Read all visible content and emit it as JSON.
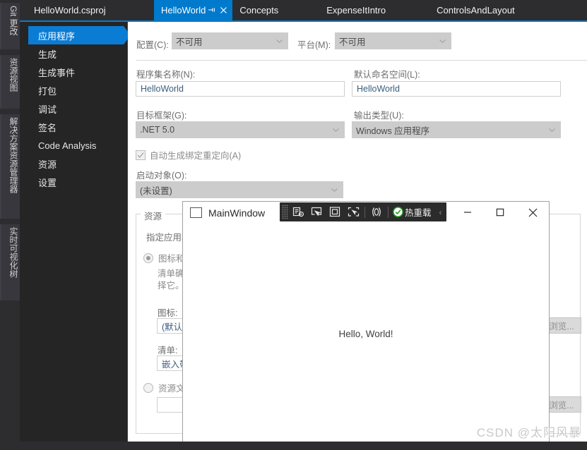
{
  "colors": {
    "accent": "#007acc",
    "selection": "#0b7cd4",
    "shell_bg": "#2d2d30",
    "nav_bg": "#252526",
    "page_bg": "#ffffff",
    "combo_bg": "#cccccc",
    "hotbar_bg": "#2b2b2b",
    "hotreload_green": "#3ea33e"
  },
  "vertical_dock": {
    "items": [
      {
        "label": "Git 更改",
        "name": "git-changes"
      },
      {
        "label": "资源视图",
        "name": "resource-view"
      },
      {
        "label": "解决方案资源管理器",
        "name": "solution-explorer"
      },
      {
        "label": "实时可视化树",
        "name": "live-visual-tree"
      }
    ]
  },
  "document_tab": {
    "label": "HelloWorld.csproj"
  },
  "tool_tabs": [
    {
      "label": "HelloWorld",
      "active": true,
      "pin_icon": "pin-icon",
      "close_icon": "close-icon"
    },
    {
      "label": "Concepts",
      "active": false
    },
    {
      "label": "ExpenseItIntro",
      "active": false
    },
    {
      "label": "ControlsAndLayout",
      "active": false
    }
  ],
  "property_nav": {
    "items": [
      {
        "label": "应用程序",
        "selected": true
      },
      {
        "label": "生成",
        "selected": false
      },
      {
        "label": "生成事件",
        "selected": false
      },
      {
        "label": "打包",
        "selected": false
      },
      {
        "label": "调试",
        "selected": false
      },
      {
        "label": "签名",
        "selected": false
      },
      {
        "label": "Code Analysis",
        "selected": false
      },
      {
        "label": "资源",
        "selected": false
      },
      {
        "label": "设置",
        "selected": false
      }
    ]
  },
  "application_page": {
    "configuration": {
      "label": "配置(C):",
      "value": "不可用"
    },
    "platform": {
      "label": "平台(M):",
      "value": "不可用"
    },
    "assembly_name": {
      "label": "程序集名称(N):",
      "value": "HelloWorld"
    },
    "default_namespace": {
      "label": "默认命名空间(L):",
      "value": "HelloWorld"
    },
    "target_framework": {
      "label": "目标框架(G):",
      "value": ".NET 5.0"
    },
    "output_type": {
      "label": "输出类型(U):",
      "value": "Windows 应用程序"
    },
    "auto_binding_redirect": {
      "label": "自动生成绑定重定向(A)",
      "checked": true
    },
    "startup_object": {
      "label": "启动对象(O):",
      "value": "(未设置)"
    },
    "resources_group": {
      "title": "资源",
      "description": "指定应用程",
      "icon_manifest_radio": {
        "label": "图标和清",
        "selected": true
      },
      "icon_manifest_help": "清单确\n择它。",
      "icon": {
        "label": "图标:",
        "value": "(默认值"
      },
      "manifest": {
        "label": "清单:",
        "value": "嵌入带"
      },
      "resource_file_radio": {
        "label": "资源文件",
        "selected": false
      },
      "resource_file": {
        "value": ""
      },
      "browse_button_1": "浏览...",
      "browse_button_2": "浏览..."
    }
  },
  "main_window": {
    "title": "MainWindow",
    "app_icon": "window-icon",
    "content_text": "Hello, World!",
    "hot_reload_toolbar": {
      "grip": "drag-grip",
      "buttons": [
        {
          "name": "go-to-live-visual-tree-icon"
        },
        {
          "name": "select-element-icon"
        },
        {
          "name": "display-layout-adorners-icon"
        },
        {
          "name": "track-focused-element-icon"
        },
        {
          "name": "xaml-binding-failures-icon"
        }
      ],
      "hot_reload_label": "热重载",
      "hot_reload_status_icon": "check-circle-icon",
      "collapse_icon": "chevron-left-icon"
    },
    "window_controls": {
      "minimize": "minimize-icon",
      "maximize": "maximize-icon",
      "close": "close-icon"
    }
  },
  "watermark": {
    "text": "CSDN @太阳风暴"
  }
}
